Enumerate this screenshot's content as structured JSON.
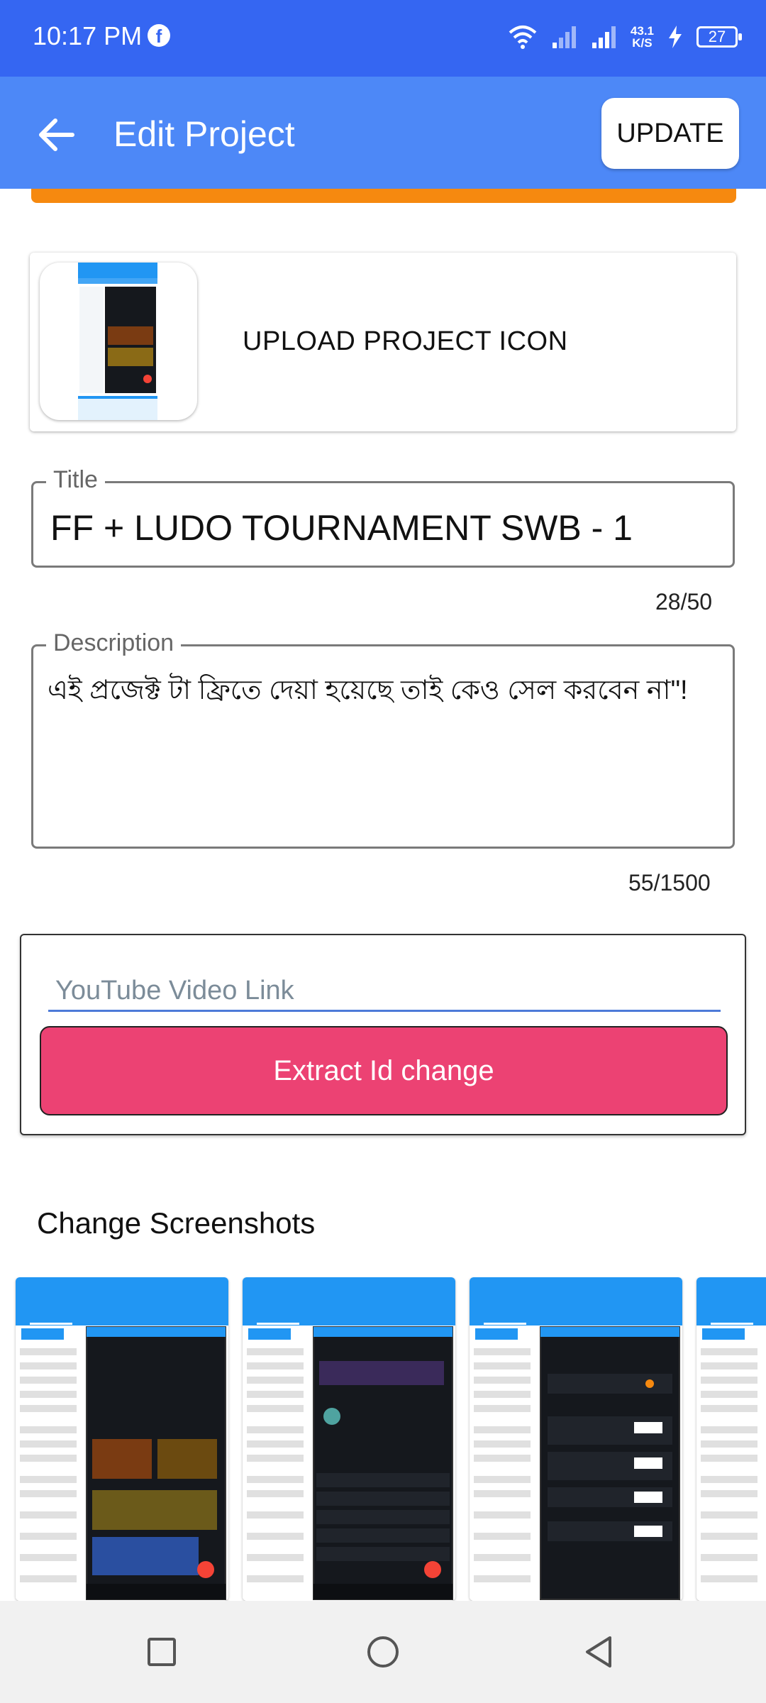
{
  "status_bar": {
    "time": "10:17 PM",
    "notification_icon": "facebook-icon",
    "speed_value": "43.1",
    "speed_unit": "K/S",
    "battery": "27"
  },
  "app_bar": {
    "title": "Edit Project",
    "update_label": "UPDATE"
  },
  "icon_card": {
    "upload_label": "UPLOAD PROJECT ICON"
  },
  "title_field": {
    "label": "Title",
    "value": "FF + LUDO TOURNAMENT SWB - 1",
    "counter": "28/50"
  },
  "description_field": {
    "label": "Description",
    "value": "এই প্রজেক্ট টা ফ্রিতে দেয়া হয়েছে তাই কেও সেল করবেন না\"!",
    "counter": "55/1500"
  },
  "youtube": {
    "placeholder": "YouTube Video Link",
    "value": "",
    "extract_label": "Extract Id change"
  },
  "screenshots": {
    "title": "Change Screenshots"
  },
  "colors": {
    "status_bar": "#3566f2",
    "app_bar": "#4d88f7",
    "accent_orange": "#f6890f",
    "extract_button": "#ec4273",
    "input_underline": "#4d7ad8"
  },
  "nav_bar": {
    "icons": [
      "recents-square-icon",
      "home-circle-icon",
      "back-triangle-icon"
    ]
  }
}
